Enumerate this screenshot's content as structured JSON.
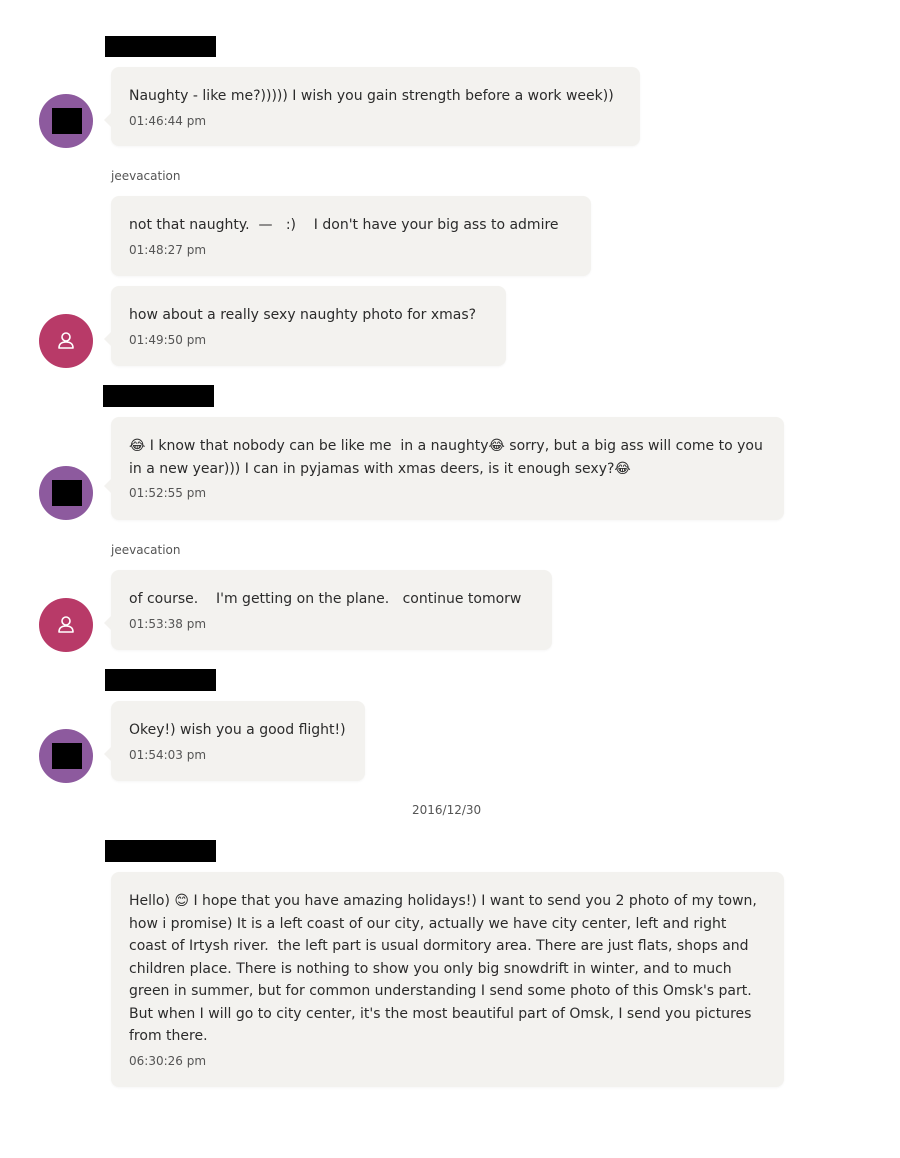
{
  "messages": [
    {
      "text": "Naughty - like me?))))) I wish you gain strength before a work week))",
      "time": "01:46:44 pm"
    },
    {
      "sender": "jeevacation",
      "text": "not that naughty.  —   :)    I don't have your big ass to admire",
      "time": "01:48:27 pm"
    },
    {
      "text": "how about a really sexy naughty photo for xmas?",
      "time": "01:49:50 pm"
    },
    {
      "text": "😂 I know that nobody can be like me  in a naughty😂 sorry, but a big ass will come to you in a new year))) I can in pyjamas with xmas deers, is it enough sexy?😂",
      "time": "01:52:55 pm"
    },
    {
      "sender": "jeevacation",
      "text": "of course.    I'm getting on the plane.   continue tomorw",
      "time": "01:53:38 pm"
    },
    {
      "text": "Okey!) wish you a good flight!)",
      "time": "01:54:03 pm"
    },
    {
      "text": "Hello) 😊 I hope that you have amazing holidays!) I want to send you 2 photo of my town, how i promise) It is a left coast of our city, actually we have city center, left and right coast of Irtysh river.  the left part is usual dormitory area. There are just flats, shops and children place. There is nothing to show you only big snowdrift in winter, and to much green in summer, but for common understanding I send some photo of this Omsk's part. But when I will go to city center, it's the most beautiful part of Omsk, I send you pictures from there.",
      "time": "06:30:26 pm"
    }
  ],
  "date_separator": "2016/12/30",
  "icons": {
    "avatar_default": "person-icon",
    "redaction": "black-box"
  },
  "colors": {
    "avatar_purple": "#8d5a9e",
    "avatar_pink": "#b83a68",
    "bubble": "#f3f2ef"
  }
}
